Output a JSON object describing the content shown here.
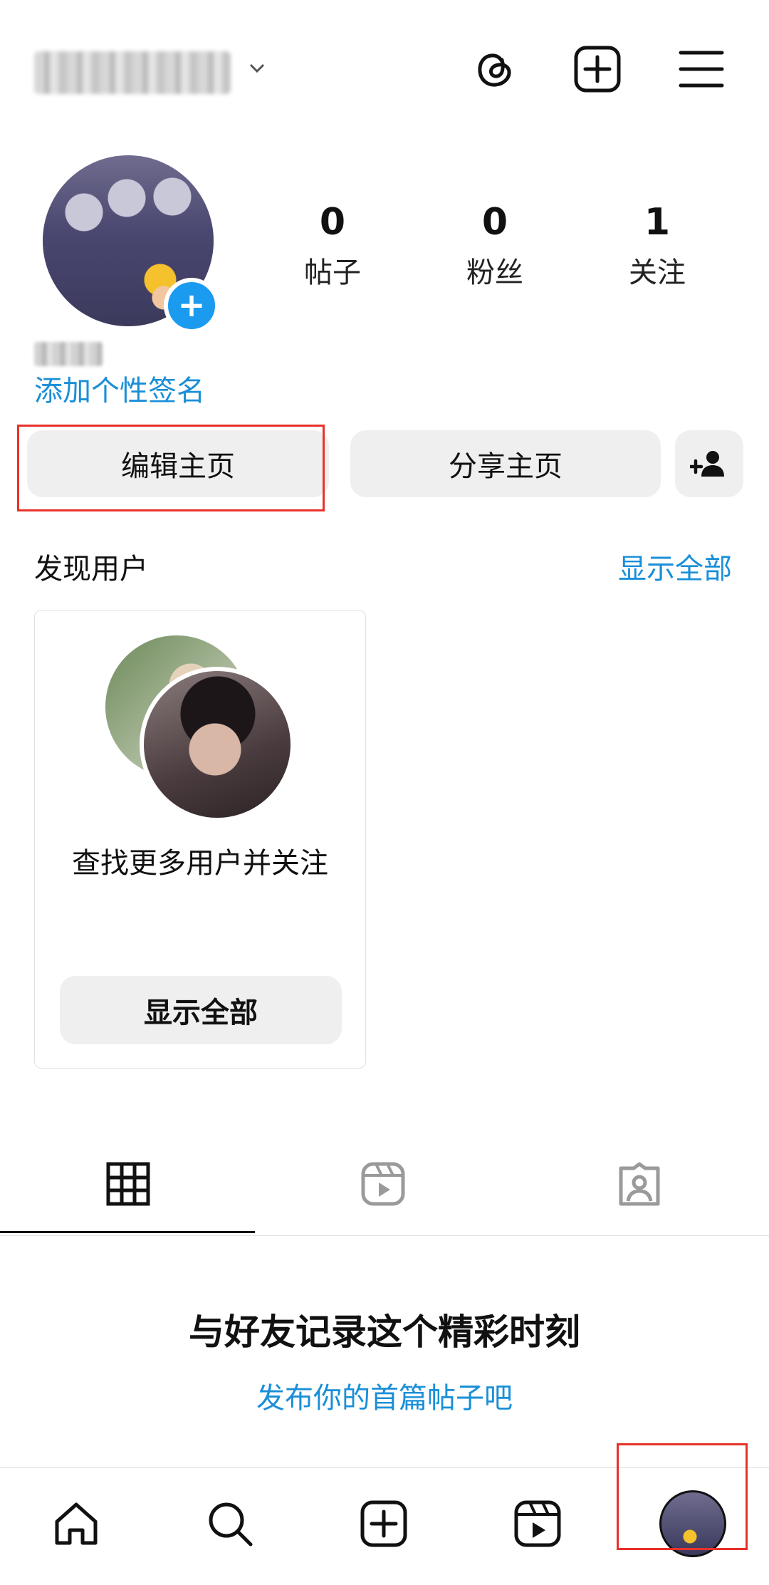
{
  "header": {
    "username_masked": "",
    "icons": [
      "threads-icon",
      "create-post-icon",
      "menu-icon"
    ]
  },
  "profile": {
    "stats": [
      {
        "value": "0",
        "label": "帖子"
      },
      {
        "value": "0",
        "label": "粉丝"
      },
      {
        "value": "1",
        "label": "关注"
      }
    ],
    "bio_link": "添加个性签名"
  },
  "actions": {
    "edit_label": "编辑主页",
    "share_label": "分享主页"
  },
  "discover": {
    "title": "发现用户",
    "show_all": "显示全部",
    "card_text": "查找更多用户并关注",
    "card_button": "显示全部"
  },
  "empty_state": {
    "title": "与好友记录这个精彩时刻",
    "link": "发布你的首篇帖子吧"
  },
  "tabs": [
    "grid-icon",
    "reels-icon",
    "tagged-icon"
  ],
  "bottom_nav": [
    "home-icon",
    "search-icon",
    "create-icon",
    "reels-icon",
    "profile-avatar"
  ],
  "colors": {
    "accent": "#1a8fd8",
    "plus_badge": "#1a9bf0",
    "highlight": "#e8312a"
  }
}
